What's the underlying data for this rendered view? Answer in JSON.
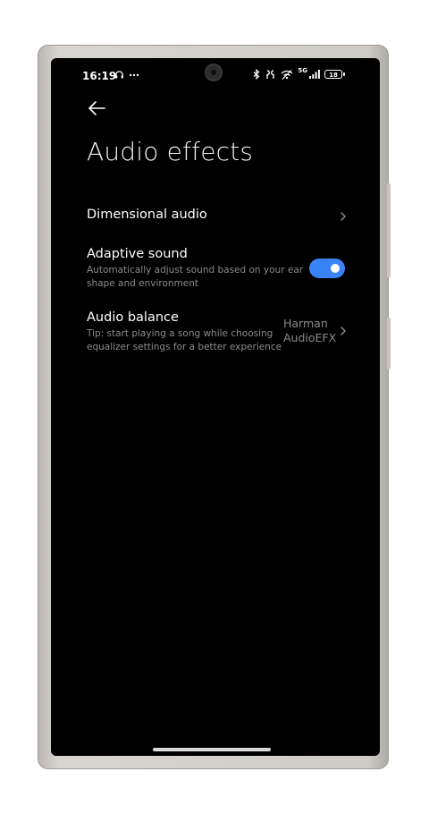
{
  "status_bar": {
    "time": "16:19",
    "headphones_icon": "headphones-icon",
    "more_icon": "more-dots-icon",
    "network_label": "5G",
    "battery_level": "18"
  },
  "header": {
    "back_icon": "arrow-left-icon",
    "title": "Audio effects"
  },
  "settings": {
    "dimensional_audio": {
      "title": "Dimensional audio"
    },
    "adaptive_sound": {
      "title": "Adaptive sound",
      "subtitle_line1": "Automatically adjust sound based on your ear",
      "subtitle_line2": "shape and environment",
      "enabled": true
    },
    "audio_balance": {
      "title": "Audio balance",
      "subtitle_line1": "Tip: start playing a song while choosing",
      "subtitle_line2": "equalizer settings for a better experience",
      "value_line1": "Harman",
      "value_line2": "AudioEFX"
    }
  },
  "colors": {
    "accent": "#3b82f6",
    "background": "#000000",
    "secondary_text": "#8b8b8b"
  }
}
